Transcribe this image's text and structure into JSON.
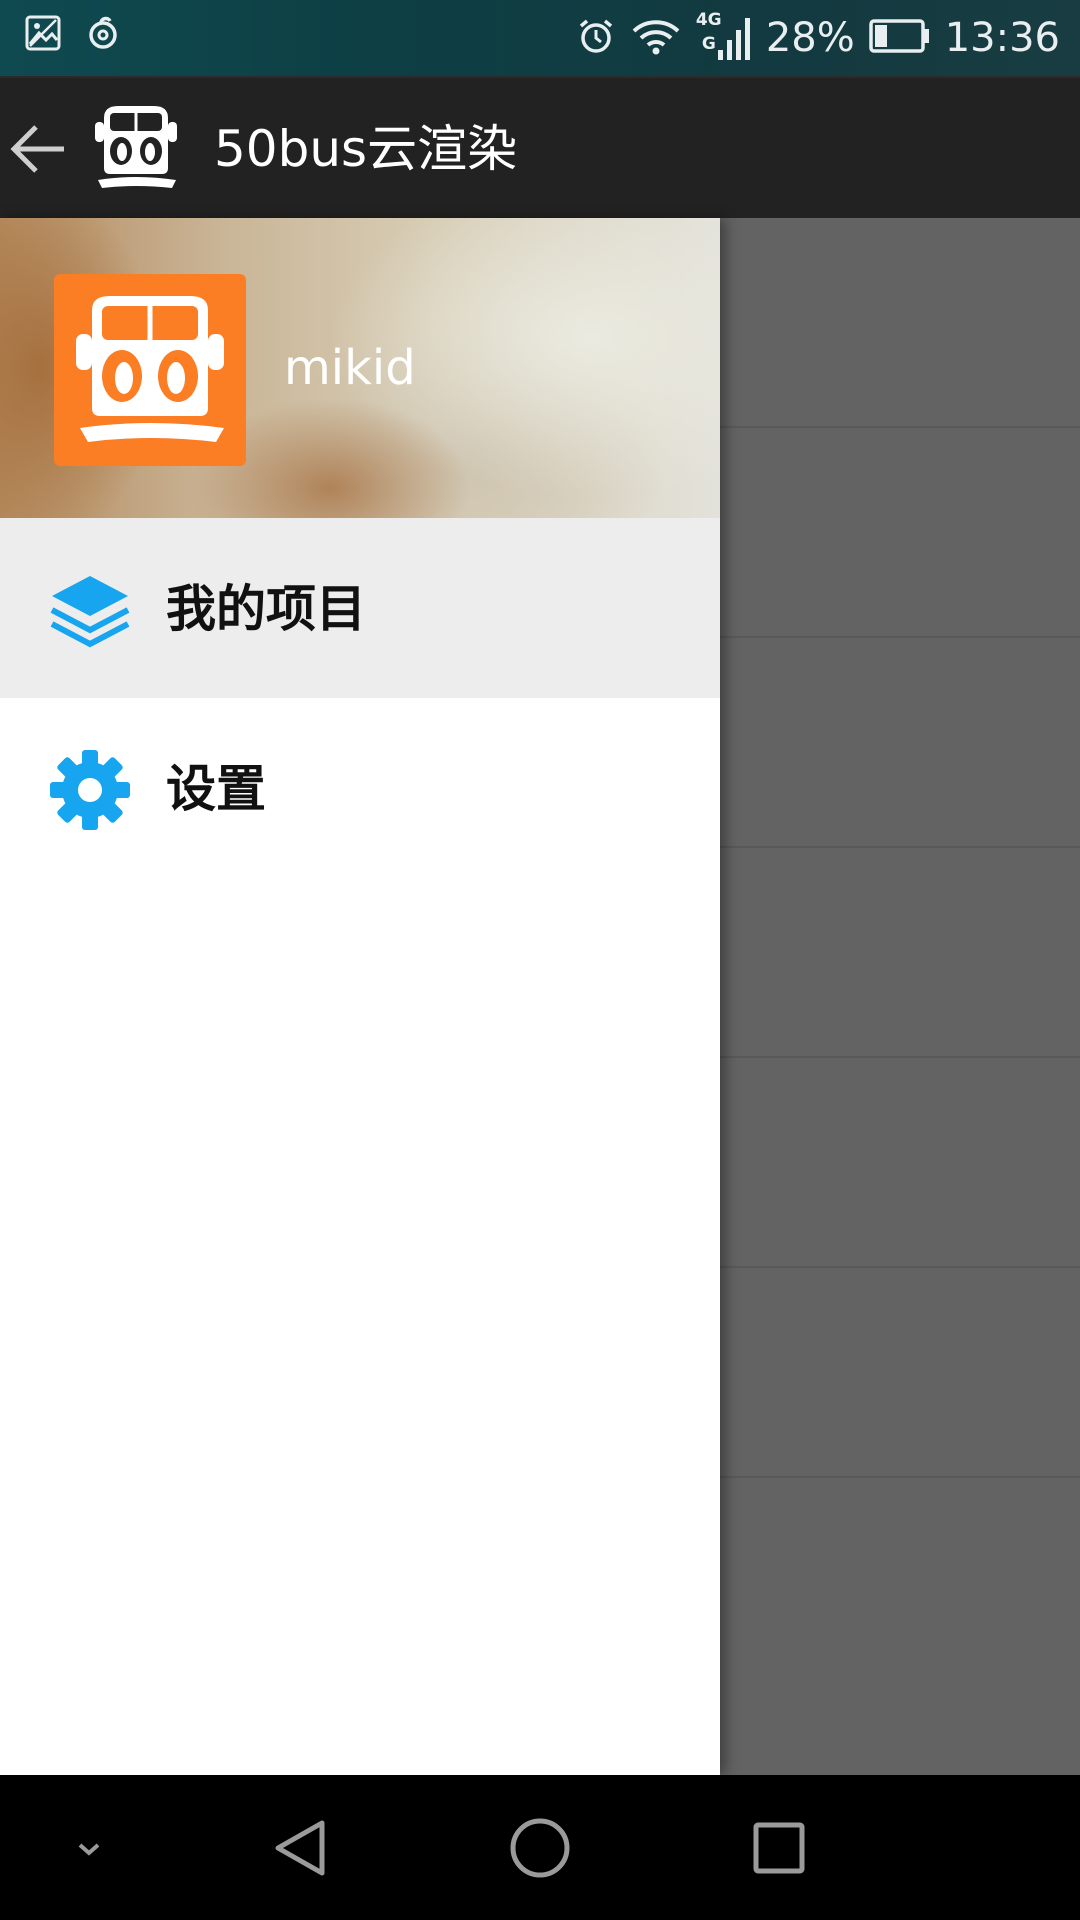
{
  "status_bar": {
    "icons_left": [
      "gallery-icon",
      "netease-music-icon"
    ],
    "icons_right": [
      "alarm-icon",
      "wifi-icon",
      "signal-4g-icon",
      "battery-icon"
    ],
    "network_label_top": "4G",
    "network_label_bottom": "G",
    "battery_percent": "28%",
    "battery_level": 0.28,
    "time": "13:36"
  },
  "app_bar": {
    "title": "50bus云渲染",
    "back_icon": "arrow-left-icon",
    "logo_icon": "bus-logo-icon"
  },
  "drawer": {
    "header": {
      "username": "mikid",
      "avatar_icon": "bus-logo-icon",
      "avatar_color": "#fb7d24"
    },
    "items": [
      {
        "label": "我的项目",
        "icon": "layers-icon",
        "selected": true
      },
      {
        "label": "设置",
        "icon": "gear-icon",
        "selected": false
      }
    ],
    "icon_color": "#16a5ee"
  },
  "nav_bar": {
    "buttons": [
      "hide-nav-icon",
      "back-triangle-icon",
      "home-circle-icon",
      "recents-square-icon"
    ]
  }
}
